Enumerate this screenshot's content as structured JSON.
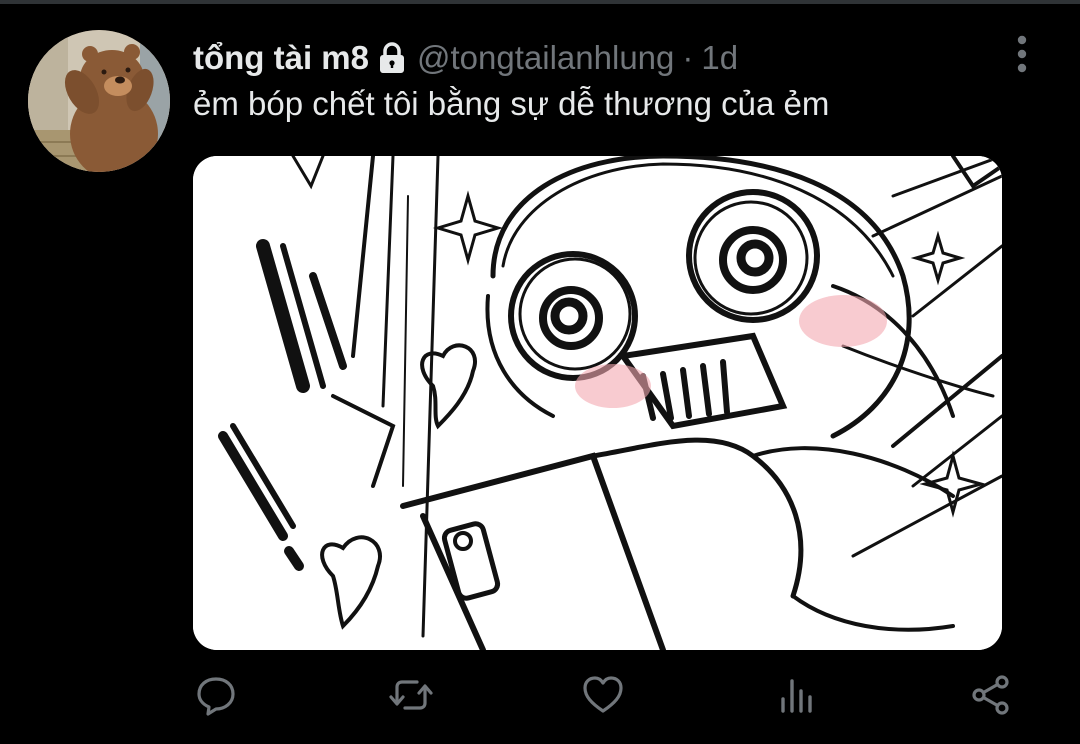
{
  "tweet": {
    "display_name": "tổng tài m8",
    "handle": "@tongtailanhlung",
    "separator": "·",
    "timestamp": "1d",
    "text": "ẻm bóp chết tôi bằng sự dễ thương của ẻm",
    "protected": true
  },
  "avatar": {
    "alt_subject": "cartoon bear"
  },
  "media": {
    "type": "image",
    "subject": "sketch drawing"
  },
  "actions": [
    {
      "name": "reply",
      "icon": "speech-bubble-icon"
    },
    {
      "name": "retweet",
      "icon": "retweet-arrows-icon"
    },
    {
      "name": "like",
      "icon": "heart-icon"
    },
    {
      "name": "views",
      "icon": "bar-chart-icon"
    },
    {
      "name": "share",
      "icon": "share-nodes-icon"
    }
  ],
  "colors": {
    "background": "#000000",
    "primary_text": "#e7e9ea",
    "secondary_text": "#71767b",
    "divider": "#2f3336"
  }
}
